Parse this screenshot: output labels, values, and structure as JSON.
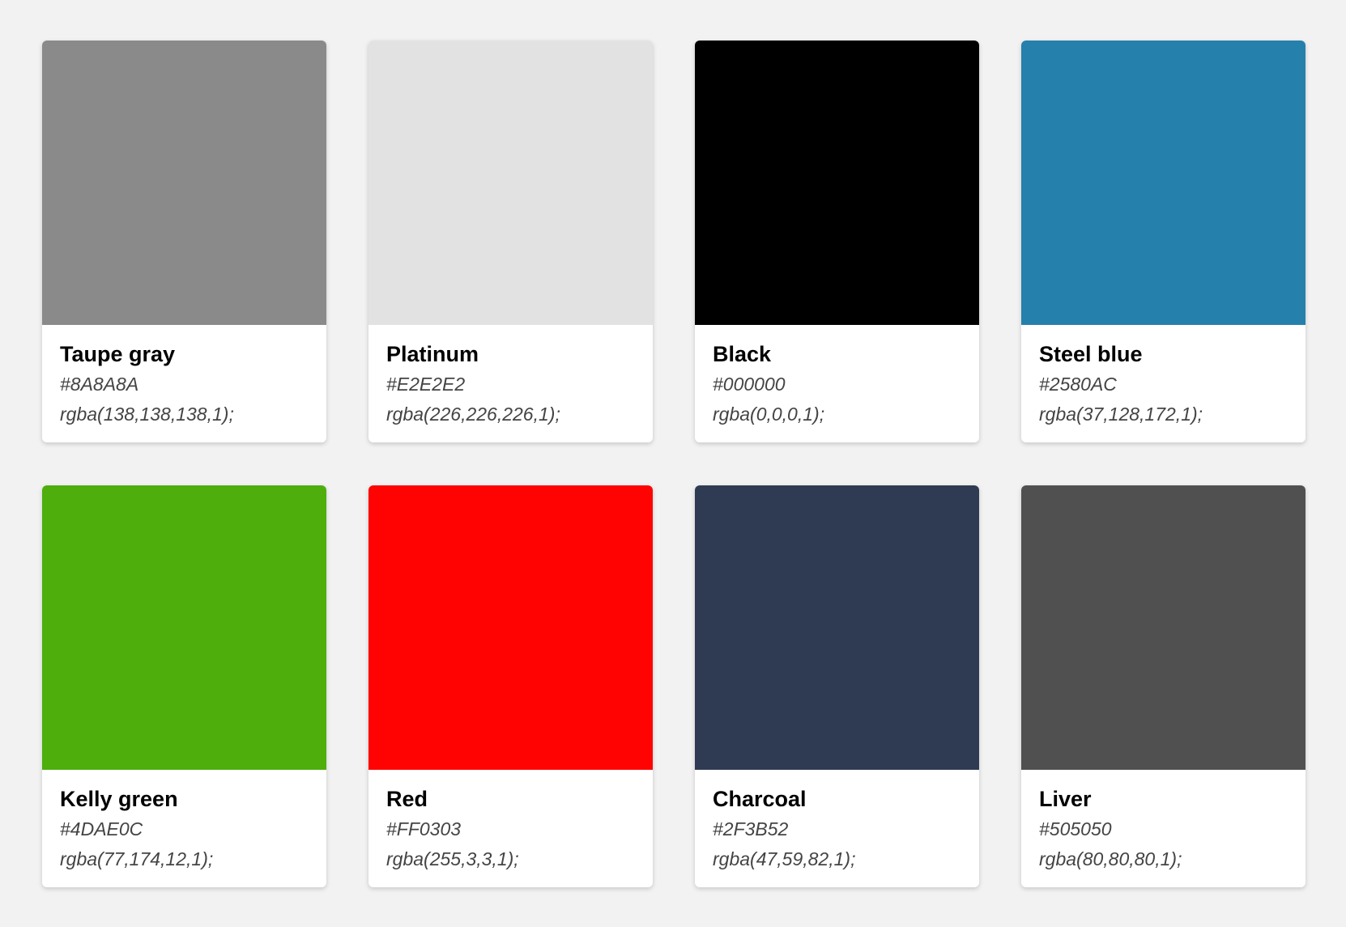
{
  "colors": [
    {
      "name": "Taupe gray",
      "hex": "#8A8A8A",
      "rgba": "rgba(138,138,138,1);",
      "swatch": "#8A8A8A"
    },
    {
      "name": "Platinum",
      "hex": "#E2E2E2",
      "rgba": "rgba(226,226,226,1);",
      "swatch": "#E2E2E2"
    },
    {
      "name": "Black",
      "hex": "#000000",
      "rgba": "rgba(0,0,0,1);",
      "swatch": "#000000"
    },
    {
      "name": "Steel blue",
      "hex": "#2580AC",
      "rgba": "rgba(37,128,172,1);",
      "swatch": "#2580AC"
    },
    {
      "name": "Kelly green",
      "hex": "#4DAE0C",
      "rgba": "rgba(77,174,12,1);",
      "swatch": "#4DAE0C"
    },
    {
      "name": "Red",
      "hex": "#FF0303",
      "rgba": "rgba(255,3,3,1);",
      "swatch": "#FF0303"
    },
    {
      "name": "Charcoal",
      "hex": "#2F3B52",
      "rgba": "rgba(47,59,82,1);",
      "swatch": "#2F3B52"
    },
    {
      "name": "Liver",
      "hex": "#505050",
      "rgba": "rgba(80,80,80,1);",
      "swatch": "#505050"
    }
  ]
}
